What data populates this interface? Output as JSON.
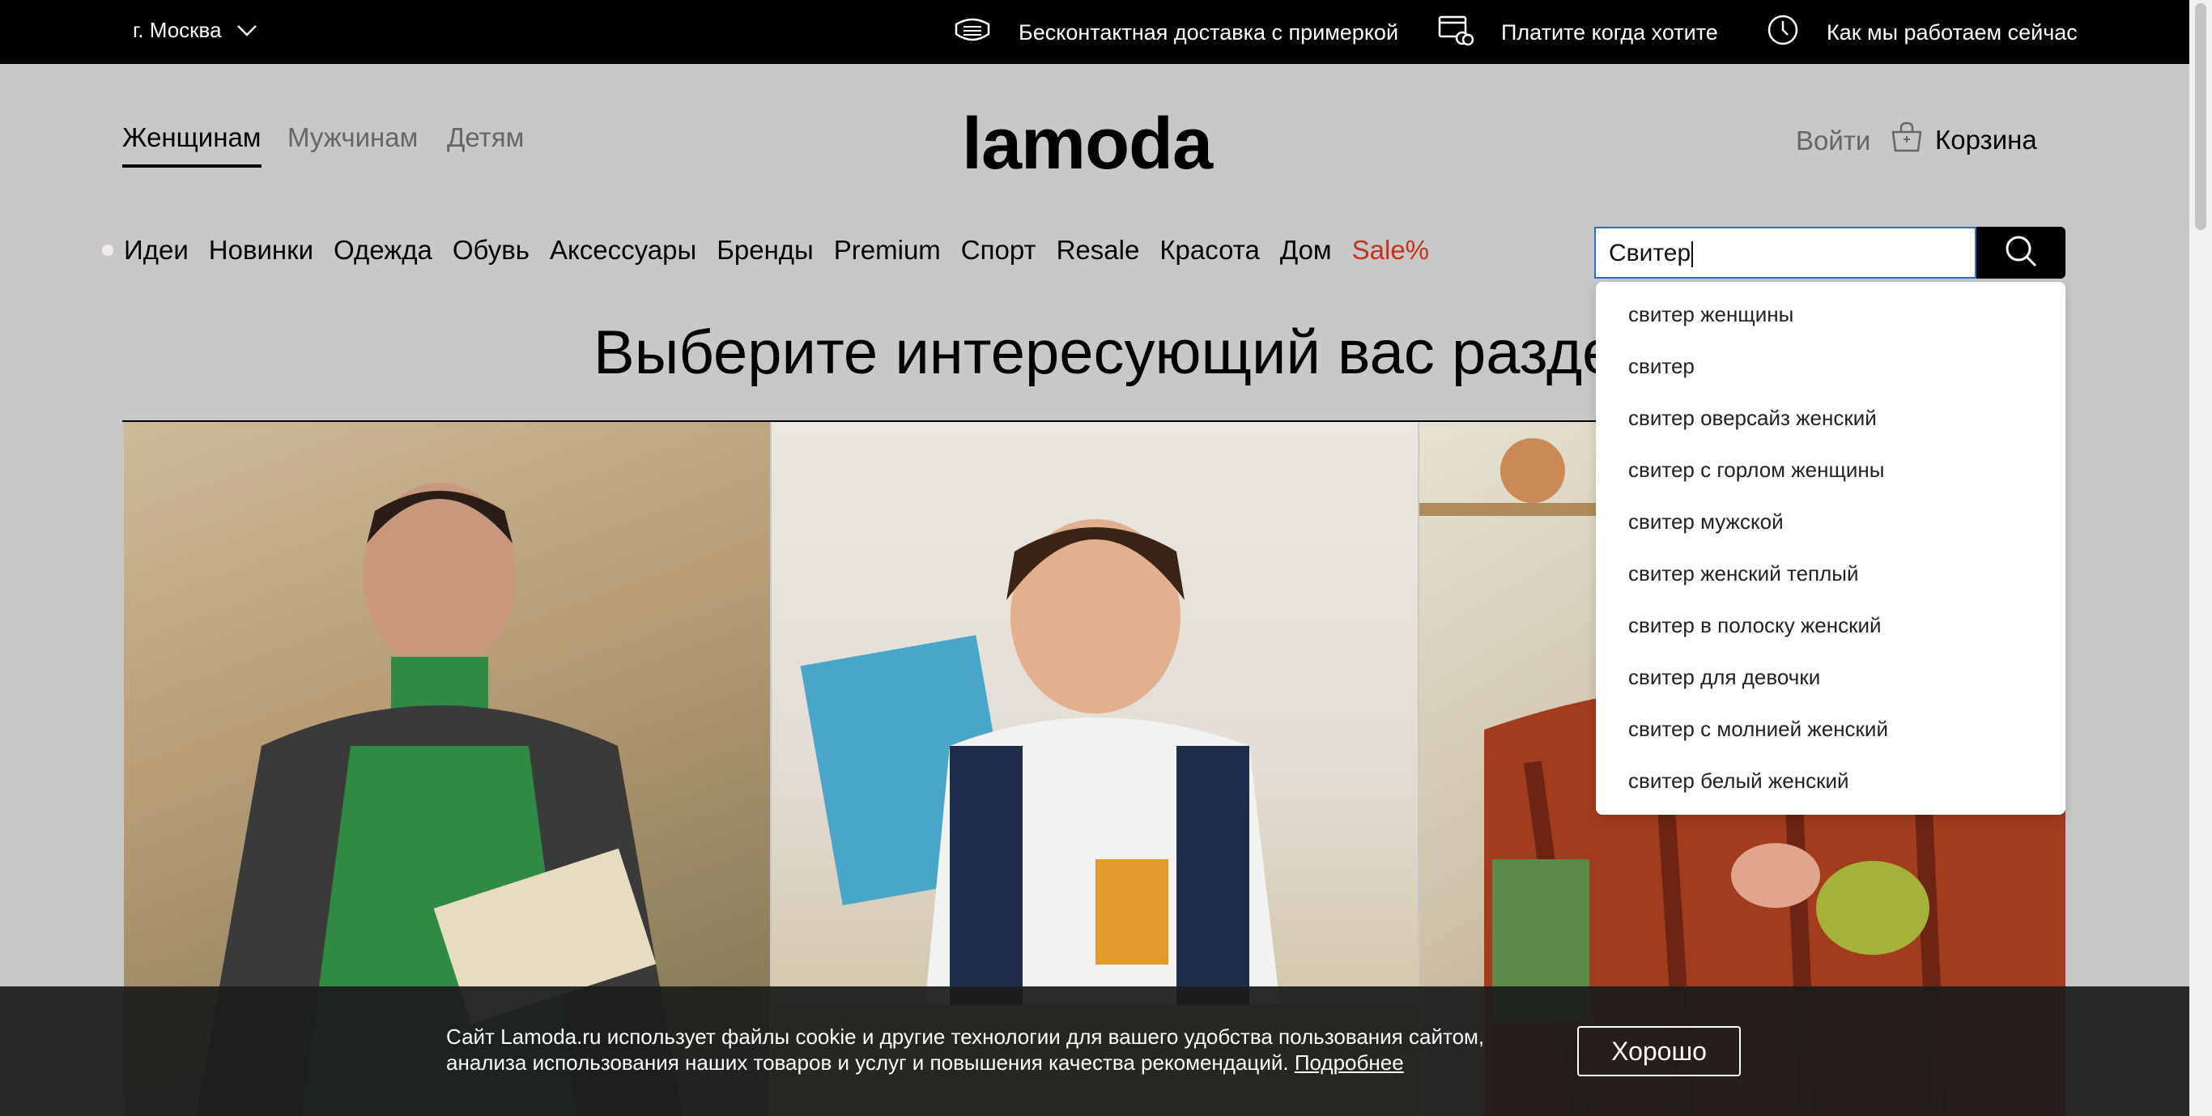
{
  "topbar": {
    "city": "г. Москва",
    "perks": [
      {
        "label": "Бесконтактная доставка с примеркой",
        "icon": "mask-icon"
      },
      {
        "label": "Платите когда хотите",
        "icon": "card-coins-icon"
      },
      {
        "label": "Как мы работаем сейчас",
        "icon": "clock-icon"
      }
    ]
  },
  "header": {
    "genders": [
      "Женщинам",
      "Мужчинам",
      "Детям"
    ],
    "logo": "lamoda",
    "login": "Войти",
    "cart": "Корзина"
  },
  "nav": {
    "items": [
      "Идеи",
      "Новинки",
      "Одежда",
      "Обувь",
      "Аксессуары",
      "Бренды",
      "Premium",
      "Спорт",
      "Resale",
      "Красота",
      "Дом"
    ],
    "sale": "Sale%"
  },
  "search": {
    "value": "Свитер",
    "suggestions": [
      "свитер женщины",
      "свитер",
      "свитер оверсайз женский",
      "свитер с горлом женщины",
      "свитер мужской",
      "свитер женский теплый",
      "свитер в полоску женский",
      "свитер для девочки",
      "свитер с молнией женский",
      "свитер белый женский"
    ]
  },
  "main": {
    "heading": "Выберите интересующий вас раздел"
  },
  "cookie": {
    "text": "Сайт Lamoda.ru использует файлы cookie и другие технологии для вашего удобства пользования сайтом, анализа использования наших товаров и услуг и повышения качества рекомендаций.",
    "more": "Подробнее",
    "ok": "Хорошо"
  },
  "colors": {
    "sale": "#c2321f",
    "search_border": "#2b6fd6",
    "overlay": "#c8c8c8"
  }
}
